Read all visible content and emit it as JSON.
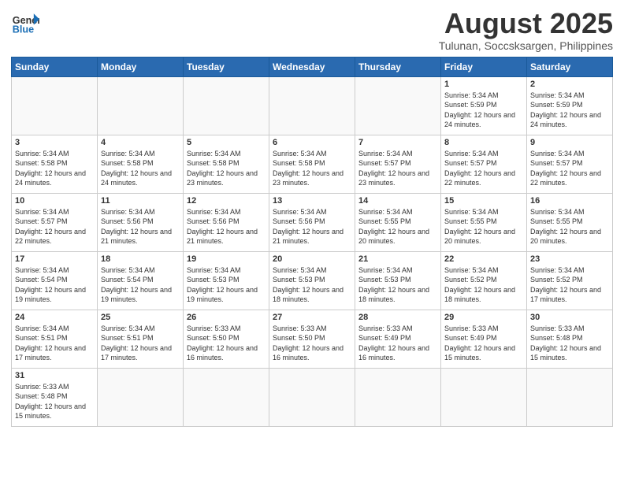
{
  "header": {
    "logo_general": "General",
    "logo_blue": "Blue",
    "month_title": "August 2025",
    "location": "Tulunan, Soccsksargen, Philippines"
  },
  "weekdays": [
    "Sunday",
    "Monday",
    "Tuesday",
    "Wednesday",
    "Thursday",
    "Friday",
    "Saturday"
  ],
  "weeks": [
    [
      {
        "day": "",
        "info": ""
      },
      {
        "day": "",
        "info": ""
      },
      {
        "day": "",
        "info": ""
      },
      {
        "day": "",
        "info": ""
      },
      {
        "day": "",
        "info": ""
      },
      {
        "day": "1",
        "info": "Sunrise: 5:34 AM\nSunset: 5:59 PM\nDaylight: 12 hours\nand 24 minutes."
      },
      {
        "day": "2",
        "info": "Sunrise: 5:34 AM\nSunset: 5:59 PM\nDaylight: 12 hours\nand 24 minutes."
      }
    ],
    [
      {
        "day": "3",
        "info": "Sunrise: 5:34 AM\nSunset: 5:58 PM\nDaylight: 12 hours\nand 24 minutes."
      },
      {
        "day": "4",
        "info": "Sunrise: 5:34 AM\nSunset: 5:58 PM\nDaylight: 12 hours\nand 24 minutes."
      },
      {
        "day": "5",
        "info": "Sunrise: 5:34 AM\nSunset: 5:58 PM\nDaylight: 12 hours\nand 23 minutes."
      },
      {
        "day": "6",
        "info": "Sunrise: 5:34 AM\nSunset: 5:58 PM\nDaylight: 12 hours\nand 23 minutes."
      },
      {
        "day": "7",
        "info": "Sunrise: 5:34 AM\nSunset: 5:57 PM\nDaylight: 12 hours\nand 23 minutes."
      },
      {
        "day": "8",
        "info": "Sunrise: 5:34 AM\nSunset: 5:57 PM\nDaylight: 12 hours\nand 22 minutes."
      },
      {
        "day": "9",
        "info": "Sunrise: 5:34 AM\nSunset: 5:57 PM\nDaylight: 12 hours\nand 22 minutes."
      }
    ],
    [
      {
        "day": "10",
        "info": "Sunrise: 5:34 AM\nSunset: 5:57 PM\nDaylight: 12 hours\nand 22 minutes."
      },
      {
        "day": "11",
        "info": "Sunrise: 5:34 AM\nSunset: 5:56 PM\nDaylight: 12 hours\nand 21 minutes."
      },
      {
        "day": "12",
        "info": "Sunrise: 5:34 AM\nSunset: 5:56 PM\nDaylight: 12 hours\nand 21 minutes."
      },
      {
        "day": "13",
        "info": "Sunrise: 5:34 AM\nSunset: 5:56 PM\nDaylight: 12 hours\nand 21 minutes."
      },
      {
        "day": "14",
        "info": "Sunrise: 5:34 AM\nSunset: 5:55 PM\nDaylight: 12 hours\nand 20 minutes."
      },
      {
        "day": "15",
        "info": "Sunrise: 5:34 AM\nSunset: 5:55 PM\nDaylight: 12 hours\nand 20 minutes."
      },
      {
        "day": "16",
        "info": "Sunrise: 5:34 AM\nSunset: 5:55 PM\nDaylight: 12 hours\nand 20 minutes."
      }
    ],
    [
      {
        "day": "17",
        "info": "Sunrise: 5:34 AM\nSunset: 5:54 PM\nDaylight: 12 hours\nand 19 minutes."
      },
      {
        "day": "18",
        "info": "Sunrise: 5:34 AM\nSunset: 5:54 PM\nDaylight: 12 hours\nand 19 minutes."
      },
      {
        "day": "19",
        "info": "Sunrise: 5:34 AM\nSunset: 5:53 PM\nDaylight: 12 hours\nand 19 minutes."
      },
      {
        "day": "20",
        "info": "Sunrise: 5:34 AM\nSunset: 5:53 PM\nDaylight: 12 hours\nand 18 minutes."
      },
      {
        "day": "21",
        "info": "Sunrise: 5:34 AM\nSunset: 5:53 PM\nDaylight: 12 hours\nand 18 minutes."
      },
      {
        "day": "22",
        "info": "Sunrise: 5:34 AM\nSunset: 5:52 PM\nDaylight: 12 hours\nand 18 minutes."
      },
      {
        "day": "23",
        "info": "Sunrise: 5:34 AM\nSunset: 5:52 PM\nDaylight: 12 hours\nand 17 minutes."
      }
    ],
    [
      {
        "day": "24",
        "info": "Sunrise: 5:34 AM\nSunset: 5:51 PM\nDaylight: 12 hours\nand 17 minutes."
      },
      {
        "day": "25",
        "info": "Sunrise: 5:34 AM\nSunset: 5:51 PM\nDaylight: 12 hours\nand 17 minutes."
      },
      {
        "day": "26",
        "info": "Sunrise: 5:33 AM\nSunset: 5:50 PM\nDaylight: 12 hours\nand 16 minutes."
      },
      {
        "day": "27",
        "info": "Sunrise: 5:33 AM\nSunset: 5:50 PM\nDaylight: 12 hours\nand 16 minutes."
      },
      {
        "day": "28",
        "info": "Sunrise: 5:33 AM\nSunset: 5:49 PM\nDaylight: 12 hours\nand 16 minutes."
      },
      {
        "day": "29",
        "info": "Sunrise: 5:33 AM\nSunset: 5:49 PM\nDaylight: 12 hours\nand 15 minutes."
      },
      {
        "day": "30",
        "info": "Sunrise: 5:33 AM\nSunset: 5:48 PM\nDaylight: 12 hours\nand 15 minutes."
      }
    ],
    [
      {
        "day": "31",
        "info": "Sunrise: 5:33 AM\nSunset: 5:48 PM\nDaylight: 12 hours\nand 15 minutes."
      },
      {
        "day": "",
        "info": ""
      },
      {
        "day": "",
        "info": ""
      },
      {
        "day": "",
        "info": ""
      },
      {
        "day": "",
        "info": ""
      },
      {
        "day": "",
        "info": ""
      },
      {
        "day": "",
        "info": ""
      }
    ]
  ]
}
